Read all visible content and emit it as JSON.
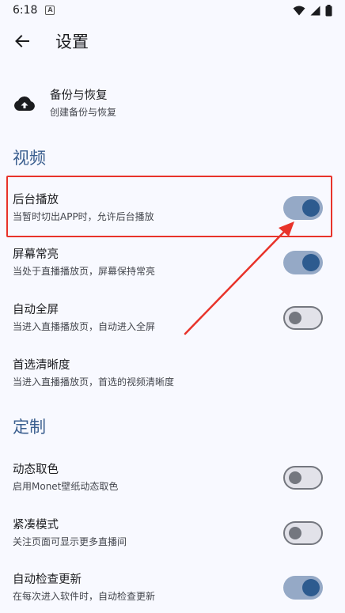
{
  "status_bar": {
    "time": "6:18",
    "badge": "A"
  },
  "app_bar": {
    "title": "设置"
  },
  "backup": {
    "title": "备份与恢复",
    "subtitle": "创建备份与恢复"
  },
  "sections": {
    "video": "视频",
    "custom": "定制"
  },
  "settings": {
    "background_play": {
      "title": "后台播放",
      "subtitle": "当暂时切出APP时，允许后台播放",
      "enabled": true
    },
    "screen_on": {
      "title": "屏幕常亮",
      "subtitle": "当处于直播播放页，屏幕保持常亮",
      "enabled": true
    },
    "auto_fullscreen": {
      "title": "自动全屏",
      "subtitle": "当进入直播播放页，自动进入全屏",
      "enabled": false
    },
    "preferred_quality": {
      "title": "首选清晰度",
      "subtitle": "当进入直播播放页，首选的视频清晰度"
    },
    "dynamic_color": {
      "title": "动态取色",
      "subtitle": "启用Monet壁纸动态取色",
      "enabled": false
    },
    "compact_mode": {
      "title": "紧凑模式",
      "subtitle": "关注页面可显示更多直播间",
      "enabled": false
    },
    "auto_update": {
      "title": "自动检查更新",
      "subtitle": "在每次进入软件时，自动检查更新",
      "enabled": true
    }
  },
  "colors": {
    "accent": "#3b5f8f",
    "switch_on_track": "#95a9c6",
    "switch_on_knob": "#2d5b8f",
    "annotation_red": "#e8332a"
  }
}
